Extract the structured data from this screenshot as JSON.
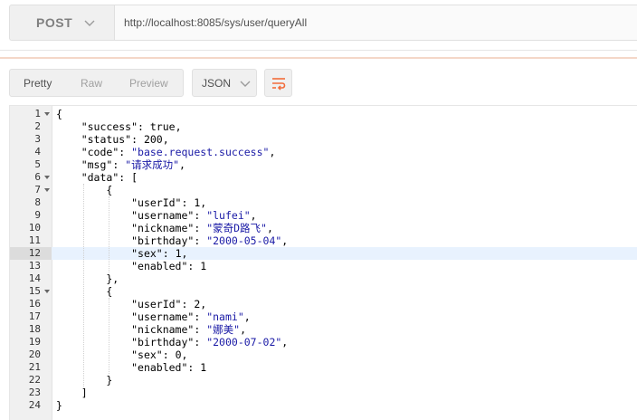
{
  "request": {
    "method": "POST",
    "url": "http://localhost:8085/sys/user/queryAll"
  },
  "response_toolbar": {
    "tabs": [
      "Pretty",
      "Raw",
      "Preview"
    ],
    "active_tab": "Pretty",
    "format": "JSON",
    "icons": {
      "method_dropdown": "chevron-down-icon",
      "format_dropdown": "chevron-down-icon",
      "wrap": "wrap-lines-icon"
    },
    "accent_color": "#f26b3a"
  },
  "editor": {
    "active_line": 12,
    "lines": [
      {
        "no": "1",
        "fold": true,
        "tokens": [
          {
            "t": "{",
            "c": "p"
          }
        ]
      },
      {
        "no": "2",
        "fold": false,
        "tokens": [
          {
            "t": "    ",
            "c": "p"
          },
          {
            "t": "\"success\"",
            "c": "k"
          },
          {
            "t": ": ",
            "c": "p"
          },
          {
            "t": "true",
            "c": "n"
          },
          {
            "t": ",",
            "c": "p"
          }
        ]
      },
      {
        "no": "3",
        "fold": false,
        "tokens": [
          {
            "t": "    ",
            "c": "p"
          },
          {
            "t": "\"status\"",
            "c": "k"
          },
          {
            "t": ": ",
            "c": "p"
          },
          {
            "t": "200",
            "c": "n"
          },
          {
            "t": ",",
            "c": "p"
          }
        ]
      },
      {
        "no": "4",
        "fold": false,
        "tokens": [
          {
            "t": "    ",
            "c": "p"
          },
          {
            "t": "\"code\"",
            "c": "k"
          },
          {
            "t": ": ",
            "c": "p"
          },
          {
            "t": "\"base.request.success\"",
            "c": "s"
          },
          {
            "t": ",",
            "c": "p"
          }
        ]
      },
      {
        "no": "5",
        "fold": false,
        "tokens": [
          {
            "t": "    ",
            "c": "p"
          },
          {
            "t": "\"msg\"",
            "c": "k"
          },
          {
            "t": ": ",
            "c": "p"
          },
          {
            "t": "\"请求成功\"",
            "c": "s"
          },
          {
            "t": ",",
            "c": "p"
          }
        ]
      },
      {
        "no": "6",
        "fold": true,
        "tokens": [
          {
            "t": "    ",
            "c": "p"
          },
          {
            "t": "\"data\"",
            "c": "k"
          },
          {
            "t": ": [",
            "c": "p"
          }
        ]
      },
      {
        "no": "7",
        "fold": true,
        "tokens": [
          {
            "t": "        {",
            "c": "p"
          }
        ]
      },
      {
        "no": "8",
        "fold": false,
        "tokens": [
          {
            "t": "            ",
            "c": "p"
          },
          {
            "t": "\"userId\"",
            "c": "k"
          },
          {
            "t": ": ",
            "c": "p"
          },
          {
            "t": "1",
            "c": "n"
          },
          {
            "t": ",",
            "c": "p"
          }
        ]
      },
      {
        "no": "9",
        "fold": false,
        "tokens": [
          {
            "t": "            ",
            "c": "p"
          },
          {
            "t": "\"username\"",
            "c": "k"
          },
          {
            "t": ": ",
            "c": "p"
          },
          {
            "t": "\"lufei\"",
            "c": "s"
          },
          {
            "t": ",",
            "c": "p"
          }
        ]
      },
      {
        "no": "10",
        "fold": false,
        "tokens": [
          {
            "t": "            ",
            "c": "p"
          },
          {
            "t": "\"nickname\"",
            "c": "k"
          },
          {
            "t": ": ",
            "c": "p"
          },
          {
            "t": "\"蒙奇D路飞\"",
            "c": "s"
          },
          {
            "t": ",",
            "c": "p"
          }
        ]
      },
      {
        "no": "11",
        "fold": false,
        "tokens": [
          {
            "t": "            ",
            "c": "p"
          },
          {
            "t": "\"birthday\"",
            "c": "k"
          },
          {
            "t": ": ",
            "c": "p"
          },
          {
            "t": "\"2000-05-04\"",
            "c": "s"
          },
          {
            "t": ",",
            "c": "p"
          }
        ]
      },
      {
        "no": "12",
        "fold": false,
        "tokens": [
          {
            "t": "            ",
            "c": "p"
          },
          {
            "t": "\"sex\"",
            "c": "k"
          },
          {
            "t": ": ",
            "c": "p"
          },
          {
            "t": "1",
            "c": "n"
          },
          {
            "t": ",",
            "c": "p"
          }
        ]
      },
      {
        "no": "13",
        "fold": false,
        "tokens": [
          {
            "t": "            ",
            "c": "p"
          },
          {
            "t": "\"enabled\"",
            "c": "k"
          },
          {
            "t": ": ",
            "c": "p"
          },
          {
            "t": "1",
            "c": "n"
          }
        ]
      },
      {
        "no": "14",
        "fold": false,
        "tokens": [
          {
            "t": "        },",
            "c": "p"
          }
        ]
      },
      {
        "no": "15",
        "fold": true,
        "tokens": [
          {
            "t": "        {",
            "c": "p"
          }
        ]
      },
      {
        "no": "16",
        "fold": false,
        "tokens": [
          {
            "t": "            ",
            "c": "p"
          },
          {
            "t": "\"userId\"",
            "c": "k"
          },
          {
            "t": ": ",
            "c": "p"
          },
          {
            "t": "2",
            "c": "n"
          },
          {
            "t": ",",
            "c": "p"
          }
        ]
      },
      {
        "no": "17",
        "fold": false,
        "tokens": [
          {
            "t": "            ",
            "c": "p"
          },
          {
            "t": "\"username\"",
            "c": "k"
          },
          {
            "t": ": ",
            "c": "p"
          },
          {
            "t": "\"nami\"",
            "c": "s"
          },
          {
            "t": ",",
            "c": "p"
          }
        ]
      },
      {
        "no": "18",
        "fold": false,
        "tokens": [
          {
            "t": "            ",
            "c": "p"
          },
          {
            "t": "\"nickname\"",
            "c": "k"
          },
          {
            "t": ": ",
            "c": "p"
          },
          {
            "t": "\"娜美\"",
            "c": "s"
          },
          {
            "t": ",",
            "c": "p"
          }
        ]
      },
      {
        "no": "19",
        "fold": false,
        "tokens": [
          {
            "t": "            ",
            "c": "p"
          },
          {
            "t": "\"birthday\"",
            "c": "k"
          },
          {
            "t": ": ",
            "c": "p"
          },
          {
            "t": "\"2000-07-02\"",
            "c": "s"
          },
          {
            "t": ",",
            "c": "p"
          }
        ]
      },
      {
        "no": "20",
        "fold": false,
        "tokens": [
          {
            "t": "            ",
            "c": "p"
          },
          {
            "t": "\"sex\"",
            "c": "k"
          },
          {
            "t": ": ",
            "c": "p"
          },
          {
            "t": "0",
            "c": "n"
          },
          {
            "t": ",",
            "c": "p"
          }
        ]
      },
      {
        "no": "21",
        "fold": false,
        "tokens": [
          {
            "t": "            ",
            "c": "p"
          },
          {
            "t": "\"enabled\"",
            "c": "k"
          },
          {
            "t": ": ",
            "c": "p"
          },
          {
            "t": "1",
            "c": "n"
          }
        ]
      },
      {
        "no": "22",
        "fold": false,
        "tokens": [
          {
            "t": "        }",
            "c": "p"
          }
        ]
      },
      {
        "no": "23",
        "fold": false,
        "tokens": [
          {
            "t": "    ]",
            "c": "p"
          }
        ]
      },
      {
        "no": "24",
        "fold": false,
        "tokens": [
          {
            "t": "}",
            "c": "p"
          }
        ]
      }
    ]
  }
}
